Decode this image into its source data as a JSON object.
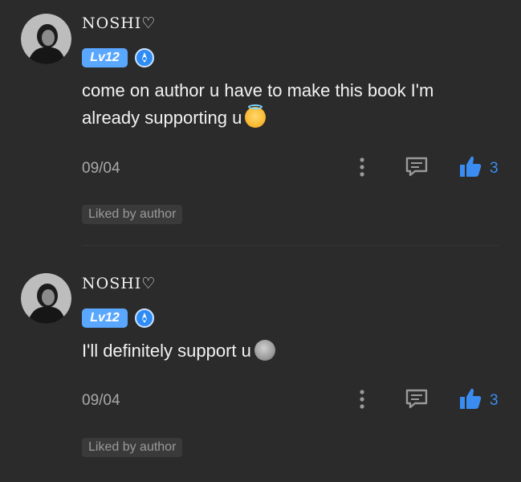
{
  "comments": [
    {
      "username": "NOSHI♡",
      "level_prefix": "Lv",
      "level_number": "12",
      "text": "come on author u have to make this book I'm already supporting u",
      "emoji": "smiling-face-with-halo",
      "date": "09/04",
      "likes": "3",
      "liked_tag": "Liked by author"
    },
    {
      "username": "NOSHI♡",
      "level_prefix": "Lv",
      "level_number": "12",
      "text": "I'll definitely support u",
      "emoji": "new-moon-face",
      "date": "09/04",
      "likes": "3",
      "liked_tag": "Liked by author"
    }
  ],
  "colors": {
    "background": "#2b2b2b",
    "accent_blue": "#3b8cf0",
    "level_badge": "#5aa7ff"
  },
  "icons": [
    "avatar",
    "level-icon",
    "more-icon",
    "reply-icon",
    "thumbs-up-icon"
  ]
}
